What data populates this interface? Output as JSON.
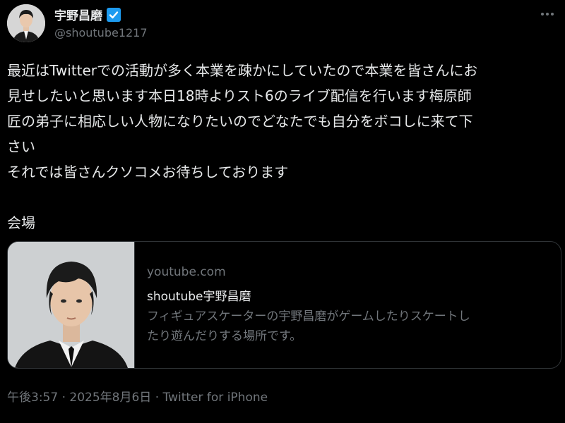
{
  "author": {
    "display_name": "宇野昌磨",
    "handle": "@shoutube1217",
    "verified_icon": "verified-badge-icon",
    "avatar_icon": "avatar"
  },
  "more_icon": "more-options-icon",
  "tweet": {
    "lines": [
      "最近はTwitterでの活動が多く本業を疎かにしていたので本業を皆さんにお",
      "見せしたいと思います本日18時よりスト6のライブ配信を行います梅原師",
      "匠の弟子に相応しい人物になりたいのでどなたでも自分をボコしに来て下",
      "さい",
      "それでは皆さんクソコメお待ちしております",
      "",
      "会場"
    ]
  },
  "card": {
    "domain": "youtube.com",
    "title": "shoutube宇野昌磨",
    "description_lines": [
      "フィギュアスケーターの宇野昌磨がゲームしたりスケートし",
      "たり遊んだりする場所です。"
    ]
  },
  "meta": {
    "time": "午後3:57",
    "separator1": " · ",
    "date": "2025年8月6日",
    "separator2": " · ",
    "source": "Twitter for iPhone"
  },
  "colors": {
    "background": "#000000",
    "text": "#e7e9ea",
    "secondary": "#71767b",
    "verified": "#1d9bf0",
    "border": "#2f3336"
  }
}
